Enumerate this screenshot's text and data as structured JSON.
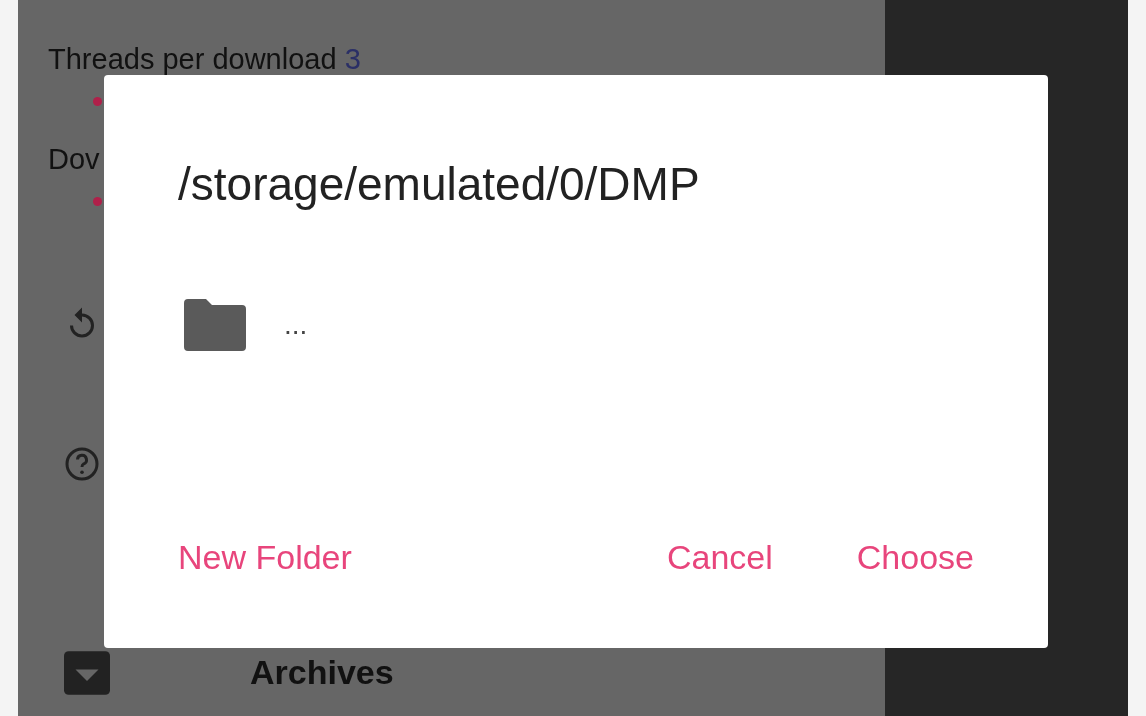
{
  "settings": [
    {
      "kind": "setting",
      "label": "Threads per download",
      "value": "3"
    },
    {
      "kind": "slider"
    },
    {
      "kind": "setting",
      "label": "Dov"
    },
    {
      "kind": "slider"
    },
    {
      "kind": "icon"
    },
    {
      "kind": "icon"
    },
    {
      "kind": "icon",
      "label": "Archives"
    }
  ],
  "dialog": {
    "title": "/storage/emulated/0/DMP",
    "entries": [
      {
        "name": "..."
      }
    ],
    "buttons": [
      {
        "label": "New Folder"
      },
      {
        "label": "Cancel"
      },
      {
        "label": "Choose"
      }
    ]
  }
}
